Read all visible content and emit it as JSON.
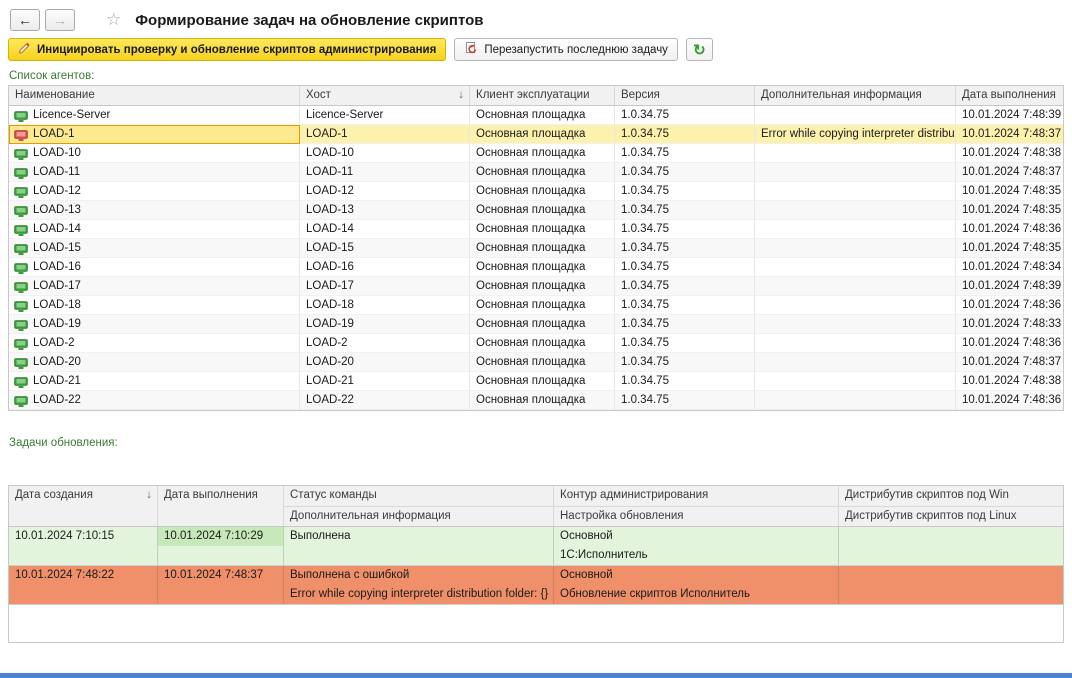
{
  "window": {
    "title": "Формирование задач на обновление скриптов"
  },
  "icons": {
    "back": "←",
    "forward": "→",
    "favorite": "☆",
    "sort_desc": "↓",
    "refresh": "↻"
  },
  "toolbar": {
    "init_label": "Инициировать проверку и обновление скриптов администрирования",
    "restart_label": "Перезапустить последнюю задачу"
  },
  "agents": {
    "label": "Список агентов:",
    "columns": {
      "name": "Наименование",
      "host": "Хост",
      "client": "Клиент эксплуатации",
      "version": "Версия",
      "info": "Дополнительная информация",
      "date": "Дата выполнения"
    },
    "rows": [
      {
        "name": "Licence-Server",
        "host": "Licence-Server",
        "client": "Основная площадка",
        "version": "1.0.34.75",
        "info": "",
        "date": "10.01.2024 7:48:39"
      },
      {
        "name": "LOAD-1",
        "host": "LOAD-1",
        "client": "Основная площадка",
        "version": "1.0.34.75",
        "info": "Error while copying interpreter distributio…",
        "date": "10.01.2024 7:48:37",
        "selected": true,
        "error": true
      },
      {
        "name": "LOAD-10",
        "host": "LOAD-10",
        "client": "Основная площадка",
        "version": "1.0.34.75",
        "info": "",
        "date": "10.01.2024 7:48:38"
      },
      {
        "name": "LOAD-11",
        "host": "LOAD-11",
        "client": "Основная площадка",
        "version": "1.0.34.75",
        "info": "",
        "date": "10.01.2024 7:48:37"
      },
      {
        "name": "LOAD-12",
        "host": "LOAD-12",
        "client": "Основная площадка",
        "version": "1.0.34.75",
        "info": "",
        "date": "10.01.2024 7:48:35"
      },
      {
        "name": "LOAD-13",
        "host": "LOAD-13",
        "client": "Основная площадка",
        "version": "1.0.34.75",
        "info": "",
        "date": "10.01.2024 7:48:35"
      },
      {
        "name": "LOAD-14",
        "host": "LOAD-14",
        "client": "Основная площадка",
        "version": "1.0.34.75",
        "info": "",
        "date": "10.01.2024 7:48:36"
      },
      {
        "name": "LOAD-15",
        "host": "LOAD-15",
        "client": "Основная площадка",
        "version": "1.0.34.75",
        "info": "",
        "date": "10.01.2024 7:48:35"
      },
      {
        "name": "LOAD-16",
        "host": "LOAD-16",
        "client": "Основная площадка",
        "version": "1.0.34.75",
        "info": "",
        "date": "10.01.2024 7:48:34"
      },
      {
        "name": "LOAD-17",
        "host": "LOAD-17",
        "client": "Основная площадка",
        "version": "1.0.34.75",
        "info": "",
        "date": "10.01.2024 7:48:39"
      },
      {
        "name": "LOAD-18",
        "host": "LOAD-18",
        "client": "Основная площадка",
        "version": "1.0.34.75",
        "info": "",
        "date": "10.01.2024 7:48:36"
      },
      {
        "name": "LOAD-19",
        "host": "LOAD-19",
        "client": "Основная площадка",
        "version": "1.0.34.75",
        "info": "",
        "date": "10.01.2024 7:48:33"
      },
      {
        "name": "LOAD-2",
        "host": "LOAD-2",
        "client": "Основная площадка",
        "version": "1.0.34.75",
        "info": "",
        "date": "10.01.2024 7:48:36"
      },
      {
        "name": "LOAD-20",
        "host": "LOAD-20",
        "client": "Основная площадка",
        "version": "1.0.34.75",
        "info": "",
        "date": "10.01.2024 7:48:37"
      },
      {
        "name": "LOAD-21",
        "host": "LOAD-21",
        "client": "Основная площадка",
        "version": "1.0.34.75",
        "info": "",
        "date": "10.01.2024 7:48:38"
      },
      {
        "name": "LOAD-22",
        "host": "LOAD-22",
        "client": "Основная площадка",
        "version": "1.0.34.75",
        "info": "",
        "date": "10.01.2024 7:48:36"
      }
    ]
  },
  "tasks": {
    "label": "Задачи обновления:",
    "columns": {
      "created": "Дата создания",
      "executed": "Дата выполнения",
      "status": "Статус команды",
      "info": "Дополнительная информация",
      "contour": "Контур администрирования",
      "setting": "Настройка обновления",
      "dist_win": "Дистрибутив скриптов под Win",
      "dist_linux": "Дистрибутив скриптов под Linux"
    },
    "rows": [
      {
        "state": "success",
        "created": "10.01.2024 7:10:15",
        "executed": "10.01.2024 7:10:29",
        "hl_exec": true,
        "status": "Выполнена",
        "info": "",
        "contour": "Основной",
        "setting": "1С:Исполнитель",
        "dist_win": "",
        "dist_linux": ""
      },
      {
        "state": "error",
        "created": "10.01.2024 7:48:22",
        "executed": "10.01.2024 7:48:37",
        "status": "Выполнена с ошибкой",
        "info": "Error while copying interpreter distribution folder: {}",
        "contour": "Основной",
        "setting": "Обновление скриптов Исполнитель",
        "dist_win": "",
        "dist_linux": ""
      }
    ]
  }
}
